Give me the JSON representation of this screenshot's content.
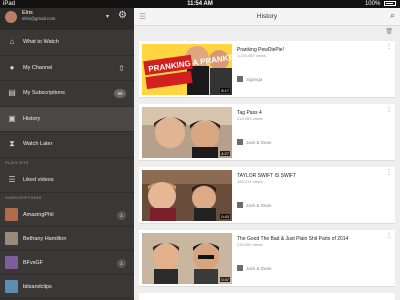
{
  "status": {
    "carrier": "iPad",
    "time": "11:54 AM",
    "battery": "100%"
  },
  "account": {
    "name": "Elris",
    "email": "elris@gmail.com"
  },
  "nav": [
    {
      "label": "What to Watch",
      "icon": "home-icon"
    },
    {
      "label": "My Channel",
      "icon": "person-icon",
      "extra": "⇧"
    },
    {
      "label": "My Subscriptions",
      "icon": "subscriptions-icon",
      "badge": "99"
    },
    {
      "label": "History",
      "icon": "history-icon",
      "active": true
    },
    {
      "label": "Watch Later",
      "icon": "hourglass-icon"
    }
  ],
  "sections": {
    "playlists": "PLAYLISTS",
    "subscriptions": "SUBSCRIPTIONS"
  },
  "playlists": [
    {
      "label": "Liked videos",
      "icon": "list-icon"
    }
  ],
  "subscriptions": [
    {
      "label": "AmazingPhil",
      "badge": "1",
      "color": "#b26b4a"
    },
    {
      "label": "Bethany Hamilton",
      "badge": "",
      "color": "#9a8a7a"
    },
    {
      "label": "BFvsGF",
      "badge": "1",
      "color": "#7d5d9a"
    },
    {
      "label": "bitsandclips",
      "badge": "",
      "color": "#5a8fb0"
    }
  ],
  "main": {
    "title": "History"
  },
  "videos": [
    {
      "title": "Pranking PewDiePie!",
      "views": "1,234,567 views",
      "channel": "Sigimga",
      "duration": "8:17"
    },
    {
      "title": "Tag Pass 4",
      "views": "218,283 views",
      "channel": "Jack & Dean",
      "duration": "4:27"
    },
    {
      "title": "TAYLOR SWIFT IS SWIFT",
      "views": "185,214 views",
      "channel": "Jack & Dean",
      "duration": "0:43"
    },
    {
      "title": "The Good The Bad & Just Plain Shit Parts of 2014",
      "views": "215,000 views",
      "channel": "Jack & Dean",
      "duration": "0:47"
    }
  ],
  "thumb_text": {
    "prank": "PRANKING A PRANKER!"
  }
}
